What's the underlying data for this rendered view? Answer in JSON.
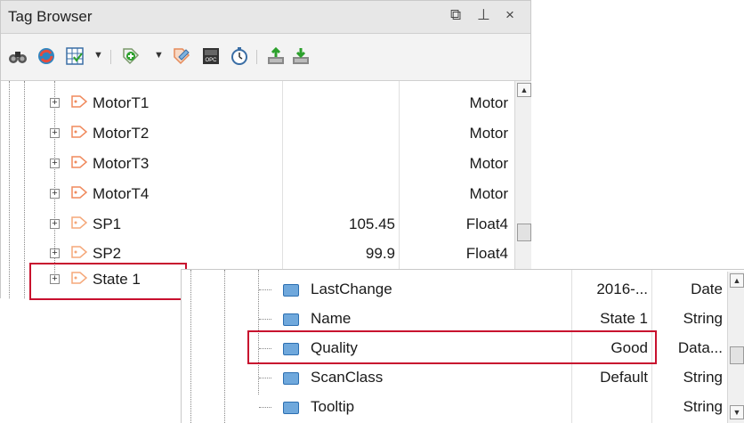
{
  "window": {
    "title": "Tag Browser",
    "controls": {
      "restore": "⧉",
      "pin": "⊥",
      "close": "×"
    }
  },
  "toolbar": {
    "icons": [
      "binoculars-icon",
      "refresh-icon",
      "table-icon",
      "dropdown-arrow",
      "add-tag-icon",
      "dropdown-arrow",
      "edit-tag-icon",
      "opc-icon",
      "timer-icon",
      "import-icon",
      "export-icon"
    ],
    "opc_label": "OPC"
  },
  "tree": {
    "rows": [
      {
        "name": "MotorT1",
        "value": "",
        "type": "Motor",
        "kind": "udt"
      },
      {
        "name": "MotorT2",
        "value": "",
        "type": "Motor",
        "kind": "udt"
      },
      {
        "name": "MotorT3",
        "value": "",
        "type": "Motor",
        "kind": "udt"
      },
      {
        "name": "MotorT4",
        "value": "",
        "type": "Motor",
        "kind": "udt"
      },
      {
        "name": "SP1",
        "value": "105.45",
        "type": "Float4",
        "kind": "memory"
      },
      {
        "name": "SP2",
        "value": "99.9",
        "type": "Float4",
        "kind": "memory"
      },
      {
        "name": "State 1",
        "value": "",
        "type": "",
        "kind": "memory"
      }
    ]
  },
  "popup": {
    "rows": [
      {
        "name": "LastChange",
        "value": "2016-...",
        "type": "Date"
      },
      {
        "name": "Name",
        "value": "State 1",
        "type": "String"
      },
      {
        "name": "Quality",
        "value": "Good",
        "type": "Data..."
      },
      {
        "name": "ScanClass",
        "value": "Default",
        "type": "String"
      },
      {
        "name": "Tooltip",
        "value": "",
        "type": "String"
      }
    ]
  },
  "colors": {
    "highlight": "#c8102e",
    "udt_tag": "#f08a5d",
    "memory_tag": "#f5a87a",
    "member_icon": "#6fa8dc"
  }
}
